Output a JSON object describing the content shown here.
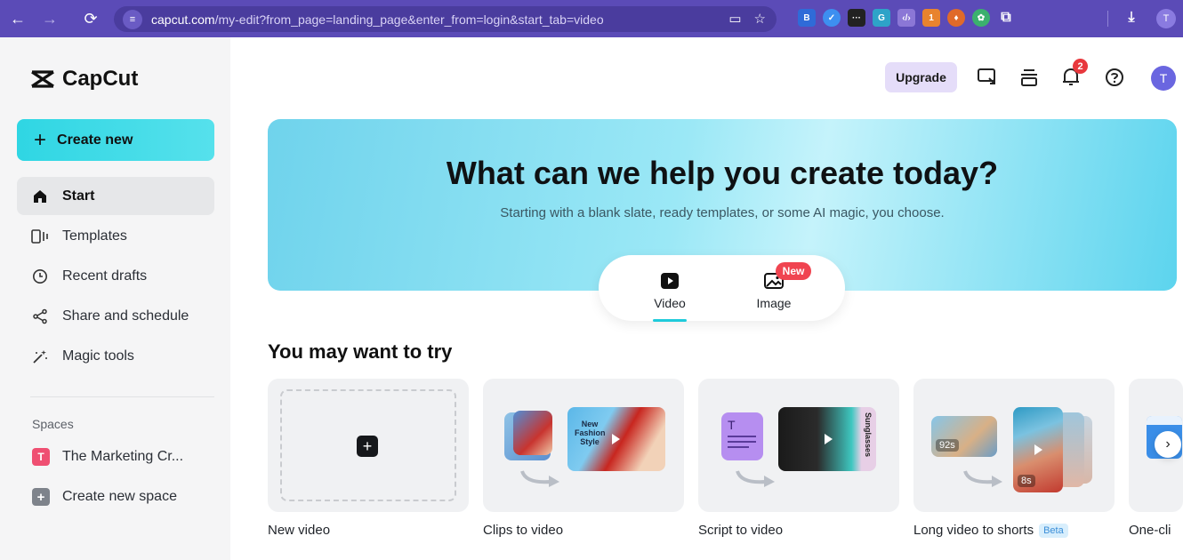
{
  "browser": {
    "url_domain": "capcut.com",
    "url_path": "/my-edit?from_page=landing_page&enter_from=login&start_tab=video",
    "profile_initial": "T"
  },
  "sidebar": {
    "logo_text": "CapCut",
    "create_new": "Create new",
    "items": [
      {
        "label": "Start",
        "icon": "home-icon"
      },
      {
        "label": "Templates",
        "icon": "templates-icon"
      },
      {
        "label": "Recent drafts",
        "icon": "clock-icon"
      },
      {
        "label": "Share and schedule",
        "icon": "share-icon"
      },
      {
        "label": "Magic tools",
        "icon": "magic-wand-icon"
      }
    ],
    "spaces_label": "Spaces",
    "spaces": [
      {
        "label": "The Marketing Cr...",
        "badge": "T"
      },
      {
        "label": "Create new space",
        "badge": "+"
      }
    ]
  },
  "header": {
    "upgrade": "Upgrade",
    "notification_count": "2",
    "avatar_initial": "T"
  },
  "hero": {
    "title": "What can we help you create today?",
    "subtitle": "Starting with a blank slate, ready templates, or some AI magic, you choose.",
    "tabs": [
      {
        "label": "Video",
        "active": true
      },
      {
        "label": "Image",
        "badge": "New"
      }
    ]
  },
  "section": {
    "title": "You may want to try",
    "cards": [
      {
        "label": "New video"
      },
      {
        "label": "Clips to video",
        "thumb_text": "New Fashion Style"
      },
      {
        "label": "Script to video",
        "thumb_text": "Sunglasses"
      },
      {
        "label": "Long video to shorts",
        "badge": "Beta",
        "dur1": "92s",
        "dur2": "8s"
      },
      {
        "label": "One-cli"
      }
    ]
  },
  "colors": {
    "browser_bar": "#5b4bb7",
    "create_button": "#2fd6e3",
    "upgrade_bg": "#e5ddf9",
    "notification": "#e8383d",
    "accent": "#1fcbdb"
  }
}
